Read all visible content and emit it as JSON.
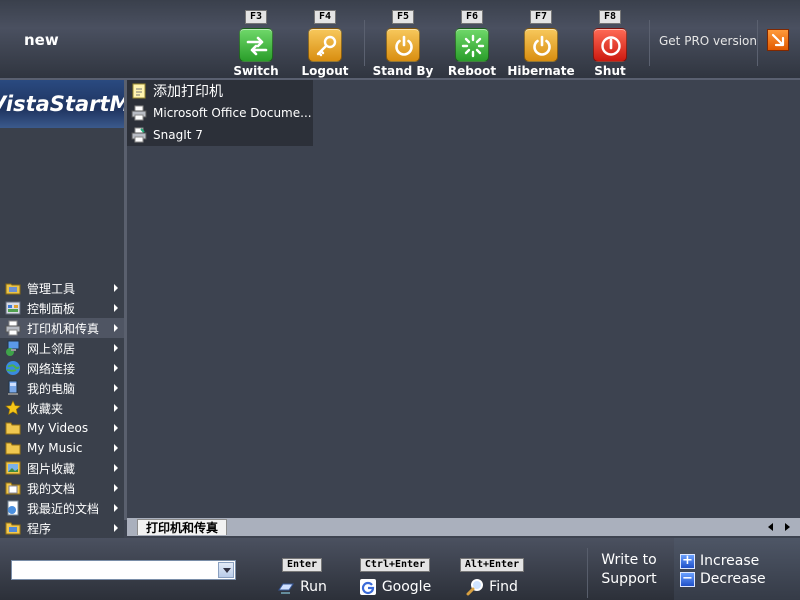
{
  "top": {
    "username": "new",
    "power_buttons": [
      {
        "key": "F3",
        "label": "Switch User",
        "icon": "switch-user-icon"
      },
      {
        "key": "F4",
        "label": "Logout",
        "icon": "key-icon"
      },
      {
        "key": "F5",
        "label": "Stand By",
        "icon": "power-icon"
      },
      {
        "key": "F6",
        "label": "Reboot",
        "icon": "reboot-icon"
      },
      {
        "key": "F7",
        "label": "Hibernate",
        "icon": "power-icon"
      },
      {
        "key": "F8",
        "label": "Shut Down",
        "icon": "shutdown-icon"
      }
    ],
    "get_pro_label": "Get PRO version"
  },
  "logo": {
    "text": "VistaStartMenu"
  },
  "left_menu": [
    {
      "label": "管理工具",
      "icon": "admin-tools-icon"
    },
    {
      "label": "控制面板",
      "icon": "control-panel-icon"
    },
    {
      "label": "打印机和传真",
      "icon": "printer-icon",
      "active": true
    },
    {
      "label": "网上邻居",
      "icon": "network-places-icon"
    },
    {
      "label": "网络连接",
      "icon": "network-connections-icon"
    },
    {
      "label": "我的电脑",
      "icon": "my-computer-icon"
    },
    {
      "label": "收藏夹",
      "icon": "star-icon"
    },
    {
      "label": "My Videos",
      "icon": "folder-icon"
    },
    {
      "label": "My Music",
      "icon": "folder-icon"
    },
    {
      "label": "图片收藏",
      "icon": "pictures-icon"
    },
    {
      "label": "我的文档",
      "icon": "documents-icon"
    },
    {
      "label": "我最近的文档",
      "icon": "recent-documents-icon"
    },
    {
      "label": "程序",
      "icon": "programs-icon"
    }
  ],
  "submenu": [
    {
      "label": "添加打印机",
      "icon": "add-printer-icon"
    },
    {
      "label": "Microsoft Office Docume...",
      "icon": "printer-icon"
    },
    {
      "label": "SnagIt 7",
      "icon": "printer-icon"
    }
  ],
  "breadcrumb": {
    "tab": "打印机和传真"
  },
  "bottom": {
    "run": {
      "key": "Enter",
      "label": "Run",
      "input_value": ""
    },
    "google": {
      "key": "Ctrl+Enter",
      "label": "Google"
    },
    "find": {
      "key": "Alt+Enter",
      "label": "Find"
    },
    "support": {
      "line1": "Write to",
      "line2": "Support"
    },
    "increase": {
      "symbol": "+",
      "label": "Increase"
    },
    "decrease": {
      "symbol": "−",
      "label": "Decrease"
    }
  }
}
